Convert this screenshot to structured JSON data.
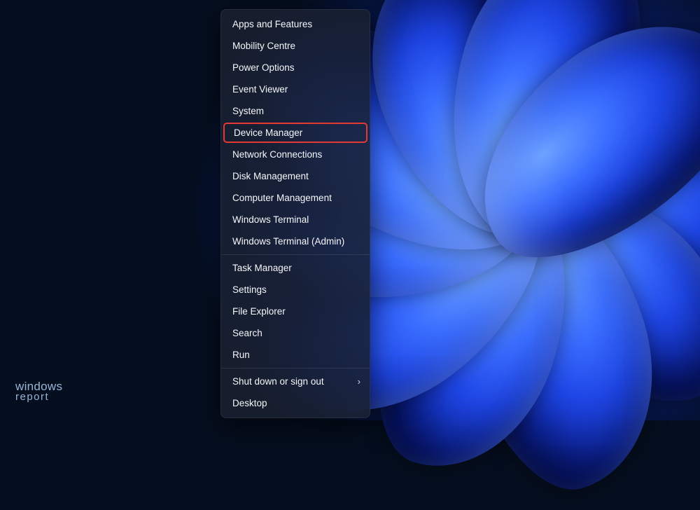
{
  "menu": {
    "group1": [
      {
        "label": "Apps and Features"
      },
      {
        "label": "Mobility Centre"
      },
      {
        "label": "Power Options"
      },
      {
        "label": "Event Viewer"
      },
      {
        "label": "System"
      },
      {
        "label": "Device Manager",
        "highlighted": true
      },
      {
        "label": "Network Connections"
      },
      {
        "label": "Disk Management"
      },
      {
        "label": "Computer Management"
      },
      {
        "label": "Windows Terminal"
      },
      {
        "label": "Windows Terminal (Admin)"
      }
    ],
    "group2": [
      {
        "label": "Task Manager"
      },
      {
        "label": "Settings"
      },
      {
        "label": "File Explorer"
      },
      {
        "label": "Search"
      },
      {
        "label": "Run"
      }
    ],
    "group3": [
      {
        "label": "Shut down or sign out",
        "submenu": true
      },
      {
        "label": "Desktop"
      }
    ]
  },
  "highlight_color": "#e53935",
  "watermark": {
    "line1": "windows",
    "line2": "report"
  }
}
